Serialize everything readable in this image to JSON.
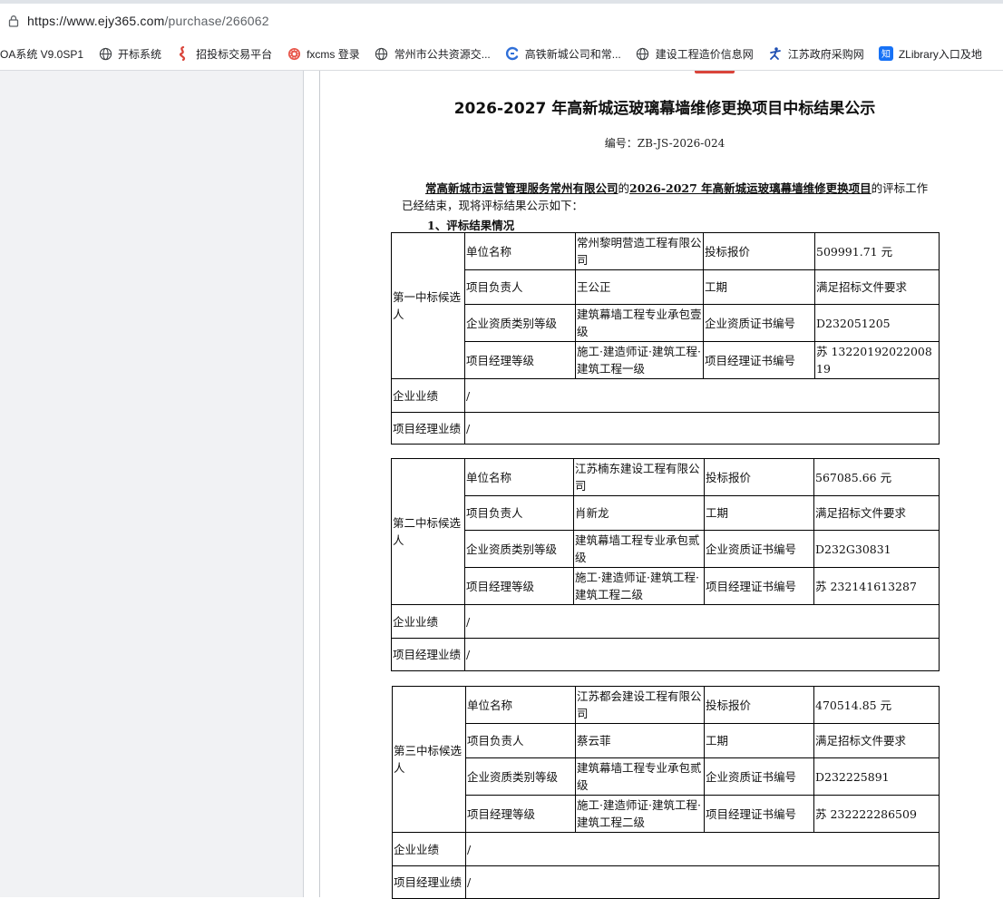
{
  "browser": {
    "url_host": "https://www.ejy365.com",
    "url_path": "/purchase/266062",
    "bookmarks": [
      {
        "label": "OA系统 V9.0SP1",
        "icon": "none"
      },
      {
        "label": "开标系统",
        "icon": "globe-icon"
      },
      {
        "label": "招投标交易平台",
        "icon": "swirl-icon"
      },
      {
        "label": "fxcms 登录",
        "icon": "stamp-icon"
      },
      {
        "label": "常州市公共资源交...",
        "icon": "globe-icon"
      },
      {
        "label": "高铁新城公司和常...",
        "icon": "c-logo-icon"
      },
      {
        "label": "建设工程造价信息网",
        "icon": "globe-icon"
      },
      {
        "label": "江苏政府采购网",
        "icon": "figure-icon"
      },
      {
        "label": "ZLibrary入口及地",
        "icon": "zhi-icon"
      }
    ],
    "zhi_glyph": "知",
    "colors": {
      "accent_red": "#d9443a",
      "zhi_blue": "#1772f6"
    }
  },
  "document": {
    "title": "2026-2027 年高新城运玻璃幕墙维修更换项目中标结果公示",
    "code": "编号：ZB-JS-2026-024",
    "intro_owner": "常高新城市运营管理服务常州有限公司",
    "intro_of": "的",
    "intro_project": "2026-2027 年高新城运玻璃幕墙维修更换项目",
    "intro_rest": "的评标工作已经结束，现将评标结果公示如下：",
    "section_title": "1、评标结果情况",
    "labels": {
      "unit_name": "单位名称",
      "bid_price": "投标报价",
      "project_lead": "项目负责人",
      "duration": "工期",
      "qual_level": "企业资质类别等级",
      "qual_cert": "企业资质证书编号",
      "pm_level": "项目经理等级",
      "pm_cert": "项目经理证书编号",
      "company_perf": "企业业绩",
      "pm_perf": "项目经理业绩"
    },
    "candidates": [
      {
        "rank_label": "第一中标候选人",
        "unit_name": "常州黎明营造工程有限公司",
        "bid_price": "509991.71 元",
        "project_lead": "王公正",
        "duration": "满足招标文件要求",
        "qual_level": "建筑幕墙工程专业承包壹级",
        "qual_cert": "D232051205",
        "pm_level": "施工·建造师证·建筑工程·建筑工程一级",
        "pm_cert": "苏 1322019202200819",
        "company_perf": "/",
        "pm_perf": "/"
      },
      {
        "rank_label": "第二中标候选人",
        "unit_name": "江苏楠东建设工程有限公司",
        "bid_price": "567085.66 元",
        "project_lead": "肖新龙",
        "duration": "满足招标文件要求",
        "qual_level": "建筑幕墙工程专业承包贰级",
        "qual_cert": "D232G30831",
        "pm_level": "施工·建造师证·建筑工程·建筑工程二级",
        "pm_cert": "苏 232141613287",
        "company_perf": "/",
        "pm_perf": "/"
      },
      {
        "rank_label": "第三中标候选人",
        "unit_name": "江苏都会建设工程有限公司",
        "bid_price": "470514.85 元",
        "project_lead": "蔡云菲",
        "duration": "满足招标文件要求",
        "qual_level": "建筑幕墙工程专业承包贰级",
        "qual_cert": "D232225891",
        "pm_level": "施工·建造师证·建筑工程·建筑工程二级",
        "pm_cert": "苏 232222286509",
        "company_perf": "/",
        "pm_perf": "/"
      }
    ]
  }
}
